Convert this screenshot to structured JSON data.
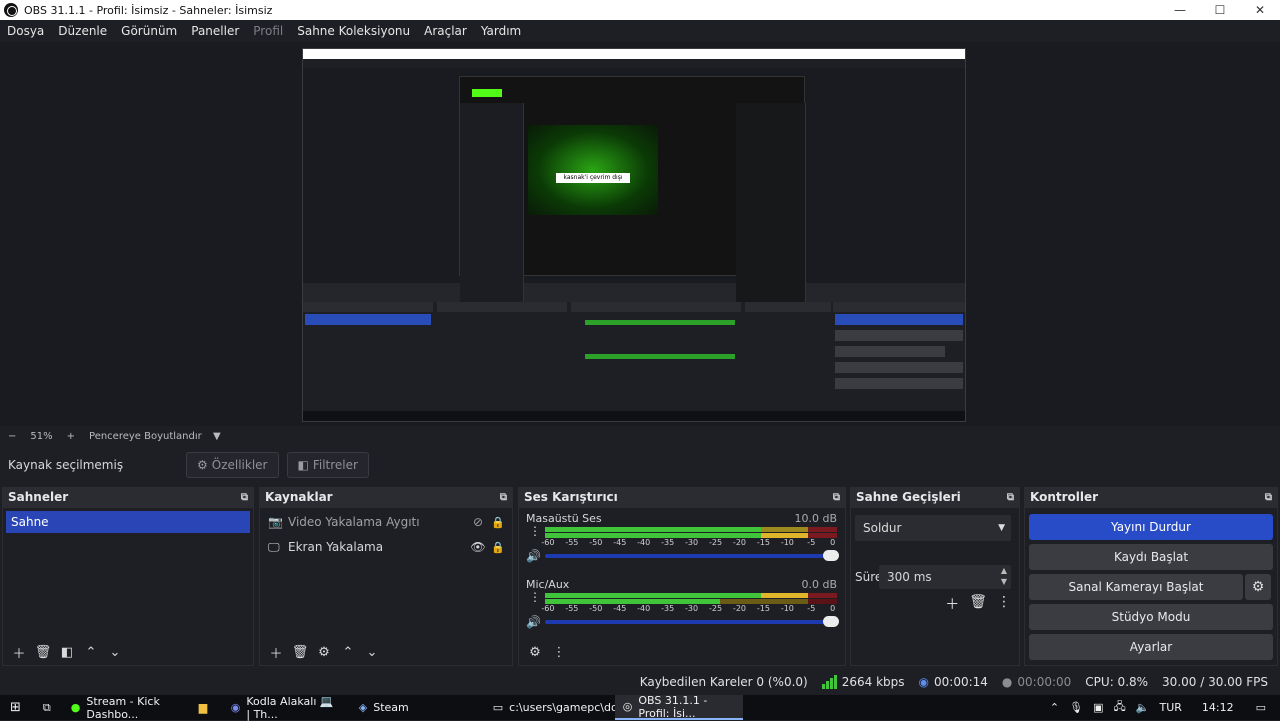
{
  "window": {
    "title": "OBS 31.1.1 - Profil: İsimsiz - Sahneler: İsimsiz",
    "minimize": "—",
    "maximize": "☐",
    "close": "✕"
  },
  "menu": [
    "Dosya",
    "Düzenle",
    "Görünüm",
    "Paneller",
    "Profil",
    "Sahne Koleksiyonu",
    "Araçlar",
    "Yardım"
  ],
  "preview": {
    "nested_offline_text": "kasnak'i çevrim dışı",
    "zoom_minus": "−",
    "zoom_value": "51%",
    "zoom_plus": "+",
    "zoom_mode": "Pencereye Boyutlandır",
    "zoom_arrow": "▼"
  },
  "source_bar": {
    "no_source": "Kaynak seçilmemiş",
    "properties": "Özellikler",
    "filters": "Filtreler"
  },
  "scenes": {
    "title": "Sahneler",
    "items": [
      "Sahne"
    ]
  },
  "sources": {
    "title": "Kaynaklar",
    "items": [
      {
        "name": "Video Yakalama Aygıtı",
        "icon": "camera-icon",
        "glyph": "📷",
        "visible_glyph": "⊘"
      },
      {
        "name": "Ekran Yakalama",
        "icon": "monitor-icon",
        "glyph": "🖵",
        "visible_glyph": "👁"
      }
    ]
  },
  "mixer": {
    "title": "Ses Karıştırıcı",
    "tracks": [
      {
        "name": "Masaüstü Ses",
        "value": "10.0 dB"
      },
      {
        "name": "Mic/Aux",
        "value": "0.0 dB"
      }
    ],
    "ticks": [
      "-60",
      "-55",
      "-50",
      "-45",
      "-40",
      "-35",
      "-30",
      "-25",
      "-20",
      "-15",
      "-10",
      "-5",
      "0"
    ]
  },
  "transitions": {
    "title": "Sahne Geçişleri",
    "selected": "Soldur",
    "duration_label": "Süre",
    "duration_value": "300 ms"
  },
  "controls": {
    "title": "Kontroller",
    "stop_stream": "Yayını Durdur",
    "start_recording": "Kaydı Başlat",
    "start_virtual_cam": "Sanal Kamerayı Başlat",
    "studio_mode": "Stüdyo Modu",
    "settings": "Ayarlar"
  },
  "status": {
    "dropped_frames": "Kaybedilen Kareler 0 (%0.0)",
    "bitrate": "2664 kbps",
    "stream_time": "00:00:14",
    "record_time": "00:00:00",
    "cpu": "CPU: 0.8%",
    "fps": "30.00 / 30.00 FPS"
  },
  "taskbar": {
    "tasks": [
      {
        "label": "Stream - Kick Dashbo...",
        "icon": "kick-icon",
        "glyph": "●"
      },
      {
        "label": "",
        "icon": "folder-icon",
        "glyph": "▆"
      },
      {
        "label": "Kodla Alakalı 💻 | Th...",
        "icon": "discord-icon",
        "glyph": "◉"
      },
      {
        "label": "Steam",
        "icon": "steam-icon",
        "glyph": "◈"
      },
      {
        "label": "c:\\users\\gamepc\\dow...",
        "icon": "terminal-icon",
        "glyph": "▭"
      },
      {
        "label": "OBS 31.1.1 - Profil: İsi...",
        "icon": "obs-icon",
        "glyph": "◎"
      }
    ],
    "language": "TUR",
    "clock": "14:12"
  },
  "colors": {
    "accent": "#284cc8",
    "meter_green": "#3fc43a",
    "meter_yellow": "#e0b52a",
    "meter_red": "#c8202a",
    "kick_green": "#53fc18"
  }
}
